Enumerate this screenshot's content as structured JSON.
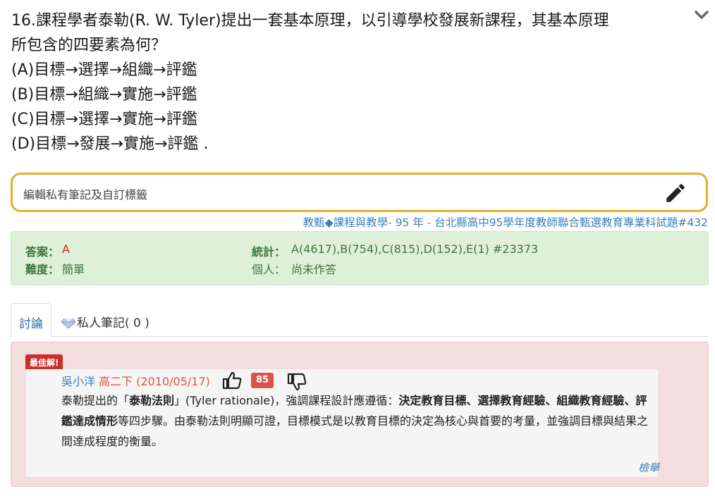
{
  "question": {
    "lines": [
      "16.課程學者泰勒(R. W. Tyler)提出一套基本原理，以引導學校發展新課程，其基本原理",
      "所包含的四要素為何？",
      "(A)目標→選擇→組織→評鑑",
      "(B)目標→組織→實施→評鑑",
      "(C)目標→選擇→實施→評鑑",
      "(D)目標→發展→實施→評鑑 ."
    ],
    "collapse_icon": "chevron-down-icon"
  },
  "note": {
    "placeholder": "編輯私有筆記及自訂標籤",
    "edit_icon": "pencil-icon"
  },
  "source": "教甄◆課程與教學- 95 年 - 台北縣高中95學年度教師聯合甄選教育專業科試題#432",
  "answer_panel": {
    "answer_label": "答案：",
    "answer_value": "A",
    "difficulty_label": "難度：",
    "difficulty_value": "簡單",
    "stats_label": "統計：",
    "stats_value": "A(4617),B(754),C(815),D(152),E(1) #23373",
    "personal_label": "個人：",
    "personal_value": "尚未作答"
  },
  "tabs": {
    "discuss": "討論",
    "notes": "私人筆記( 0 )"
  },
  "discussion": {
    "badge": "最佳解!",
    "author": "吳小洋",
    "meta": "高二下 (2010/05/17)",
    "votes": "85",
    "body": {
      "p1": "泰勒提出的「",
      "b1": "泰勒法則",
      "p2": "」(Tyler rationale)，強調課程設計應遵循：",
      "b2": "決定教育目標、選擇教育經驗、組織教育經驗、評鑑達成情形",
      "p3": "等四步驟。由泰勒法則明顯可證，目標模式是以教育目標的決定為核心與首要的考量，並強調目標與結果之間達成程度的衡量。"
    },
    "report": "檢舉"
  },
  "colors": {
    "accent_border": "#e3b02b",
    "success_bg": "#dff0d8",
    "danger_bg": "#f2dede",
    "link": "#3a7fbd",
    "answer_red": "#d9231e"
  }
}
